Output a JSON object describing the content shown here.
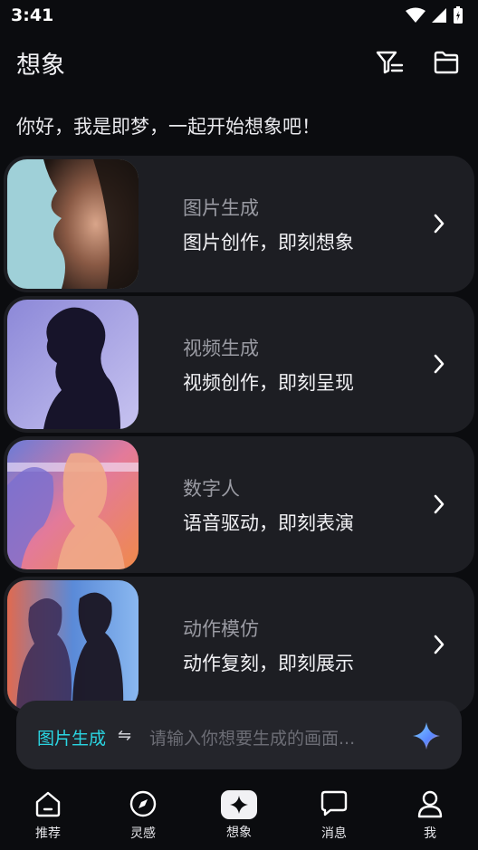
{
  "status_bar": {
    "time": "3:41"
  },
  "header": {
    "title": "想象",
    "filter_icon": "filter-icon",
    "folder_icon": "folder-icon"
  },
  "greeting": "你好，我是即梦，一起开始想象吧！",
  "cards": [
    {
      "title": "图片生成",
      "subtitle": "图片创作，即刻想象"
    },
    {
      "title": "视频生成",
      "subtitle": "视频创作，即刻呈现"
    },
    {
      "title": "数字人",
      "subtitle": "语音驱动，即刻表演"
    },
    {
      "title": "动作模仿",
      "subtitle": "动作复刻，即刻展示"
    }
  ],
  "input_bar": {
    "mode": "图片生成",
    "swap_icon": "⇋",
    "placeholder": "请输入你想要生成的画面..."
  },
  "tabs": [
    {
      "label": "推荐",
      "icon": "home-icon"
    },
    {
      "label": "灵感",
      "icon": "compass-icon"
    },
    {
      "label": "想象",
      "icon": "sparkle-icon",
      "active": true
    },
    {
      "label": "消息",
      "icon": "message-icon"
    },
    {
      "label": "我",
      "icon": "user-icon"
    }
  ],
  "colors": {
    "background": "#0b0c0f",
    "card": "#1d1e23",
    "accent": "#2ad6e3"
  }
}
